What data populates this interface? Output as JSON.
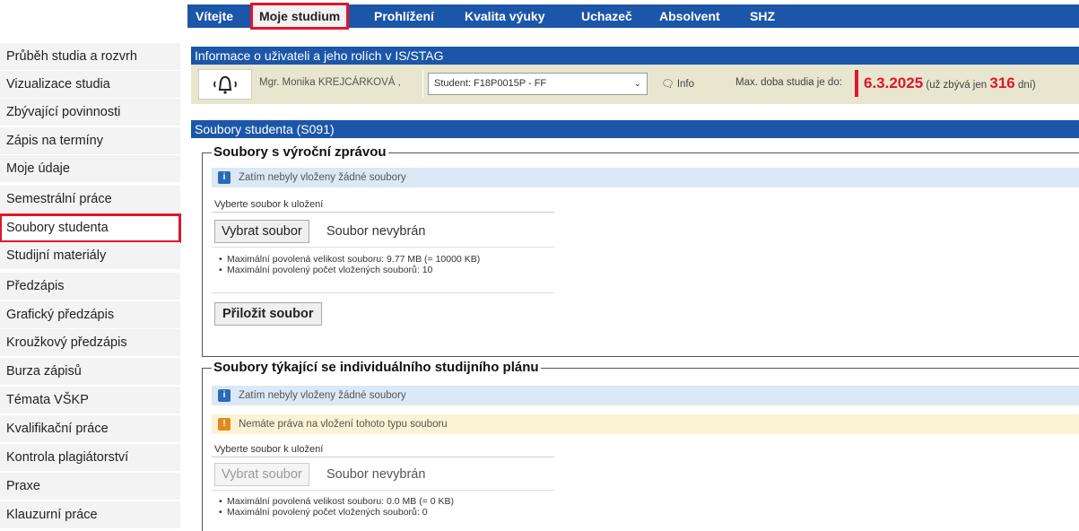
{
  "topnav": {
    "items": [
      "Vítejte",
      "Moje studium",
      "Prohlížení",
      "Kvalita výuky",
      "Uchazeč",
      "Absolvent",
      "SHZ"
    ],
    "active": "Moje studium"
  },
  "sidebar": {
    "items": [
      {
        "label": "Průběh studia a rozvrh"
      },
      {
        "label": "Vizualizace studia"
      },
      {
        "label": "Zbývající povinnosti"
      },
      {
        "label": "Zápis na termíny"
      },
      {
        "label": "Moje údaje"
      },
      {
        "label": "Semestrální práce"
      },
      {
        "label": "Soubory studenta"
      },
      {
        "label": "Studijní materiály"
      },
      {
        "label": "Předzápis"
      },
      {
        "label": "Grafický předzápis"
      },
      {
        "label": "Kroužkový předzápis"
      },
      {
        "label": "Burza zápisů"
      },
      {
        "label": "Témata VŠKP"
      },
      {
        "label": "Kvalifikační práce"
      },
      {
        "label": "Kontrola plagiátorství"
      },
      {
        "label": "Praxe"
      },
      {
        "label": "Klauzurní práce"
      }
    ],
    "active": "Soubory studenta"
  },
  "userbox": {
    "title": "Informace o uživateli a jeho rolích v IS/STAG",
    "bell_icon": "bell-icon",
    "username": "Mgr. Monika KREJCÁRKOVÁ ,",
    "role": "Student: F18P0015P - FF",
    "info_label": "Info",
    "info_icon": "chat-icon",
    "max_label": "Max. doba studia je do:",
    "deadline_date": "6.3.2025",
    "deadline_pre": "(už zbývá jen",
    "deadline_days": "316",
    "deadline_post": "dní)"
  },
  "section": {
    "title": "Soubory studenta (S091)"
  },
  "fieldset1": {
    "legend": "Soubory s výroční zprávou",
    "notice_info": "Zatím nebyly vloženy žádné soubory",
    "upload_title": "Vyberte soubor k uložení",
    "choose_button": "Vybrat soubor",
    "no_file": "Soubor nevybrán",
    "limit_size": "Maximální povolená velikost souboru: 9.77 MB (= 10000 KB)",
    "limit_count": "Maximální povolený počet vložených souborů: 10",
    "attach_button": "Přiložit soubor"
  },
  "fieldset2": {
    "legend": "Soubory týkající se individuálního studijního plánu",
    "notice_info": "Zatím nebyly vloženy žádné soubory",
    "notice_warn": "Nemáte práva na vložení tohoto typu souboru",
    "upload_title": "Vyberte soubor k uložení",
    "choose_button": "Vybrat soubor",
    "no_file": "Soubor nevybrán",
    "limit_size": "Maximální povolená velikost souboru: 0.0 MB (= 0 KB)",
    "limit_count": "Maximální povolený počet vložených souborů: 0"
  },
  "colors": {
    "nav_blue": "#1c56a8",
    "highlight_red": "#e0162b",
    "userbox_bg": "#e8e6cf",
    "info_bg": "#dbe8f6",
    "warn_bg": "#fcf3d4"
  }
}
